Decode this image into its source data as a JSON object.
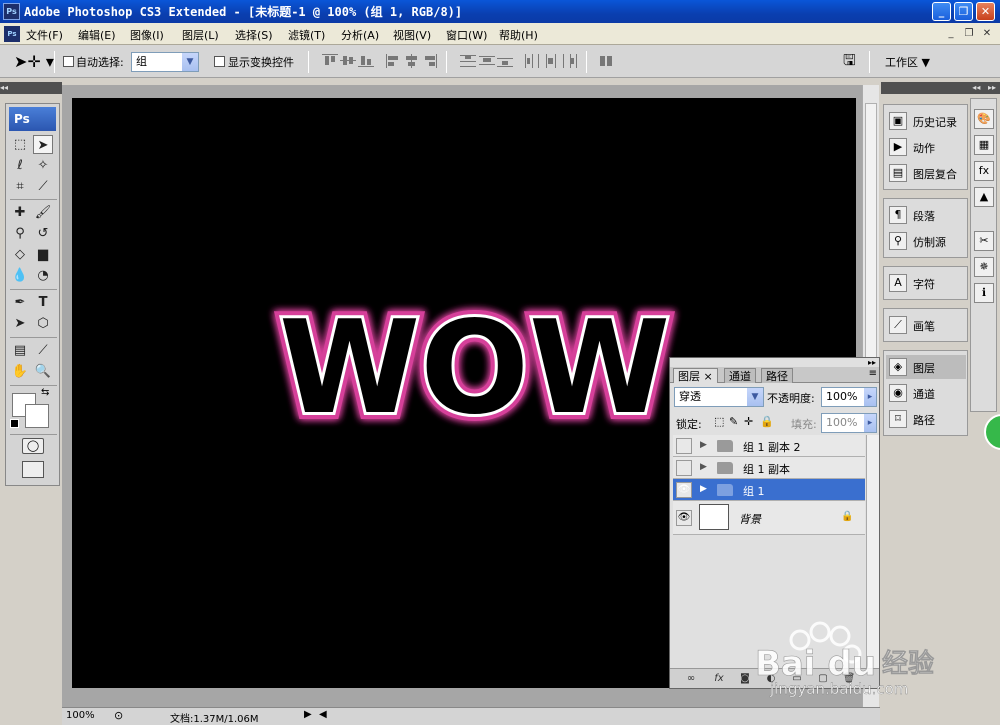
{
  "window": {
    "title": "Adobe Photoshop CS3 Extended - [未标题-1 @ 100% (组 1, RGB/8)]",
    "logo": "Ps",
    "min": "_",
    "max": "❐",
    "close": "✕"
  },
  "menu": {
    "items": [
      "文件(F)",
      "编辑(E)",
      "图像(I)",
      "图层(L)",
      "选择(S)",
      "滤镜(T)",
      "分析(A)",
      "视图(V)",
      "窗口(W)",
      "帮助(H)"
    ],
    "mdi": [
      "_",
      "❐",
      "✕"
    ]
  },
  "options": {
    "auto_select_label": "自动选择:",
    "auto_select_value": "组",
    "show_transform_label": "显示变换控件",
    "workspace_label": "工作区 ▼"
  },
  "toolbox": {
    "logo": "Ps"
  },
  "canvas": {
    "text": "WOW",
    "glow_color": "#d6409a"
  },
  "status": {
    "zoom": "100%",
    "doc": "文档:1.37M/1.06M"
  },
  "layers_panel": {
    "tabs": [
      "图层 ×",
      "通道",
      "路径"
    ],
    "blend_mode": "穿透",
    "opacity_label": "不透明度:",
    "opacity_value": "100%",
    "lock_label": "锁定:",
    "fill_label": "填充:",
    "fill_value": "100%",
    "layers": [
      {
        "name": "组 1 副本 2",
        "visible": false,
        "selected": false,
        "type": "group"
      },
      {
        "name": "组 1 副本",
        "visible": false,
        "selected": false,
        "type": "group"
      },
      {
        "name": "组 1",
        "visible": true,
        "selected": true,
        "type": "group"
      },
      {
        "name": "背景",
        "visible": true,
        "selected": false,
        "type": "background"
      }
    ]
  },
  "dock": {
    "group1": [
      "历史记录",
      "动作",
      "图层复合"
    ],
    "group2": [
      "段落",
      "仿制源"
    ],
    "group3": [
      "字符"
    ],
    "group4": [
      "画笔"
    ],
    "group5": [
      "图层",
      "通道",
      "路径"
    ]
  },
  "watermark": {
    "brand": "Bai du",
    "cn": "经验",
    "url": "jingyan.baidu.com"
  }
}
